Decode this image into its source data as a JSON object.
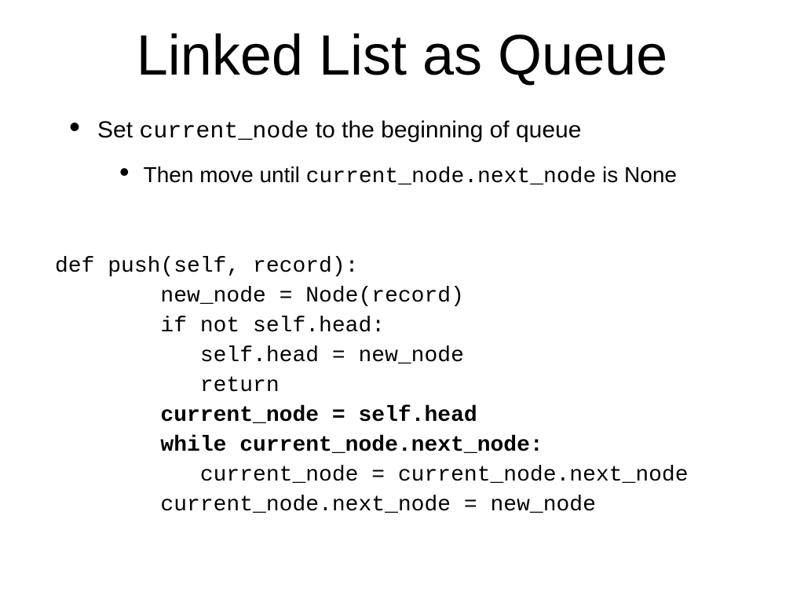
{
  "slide": {
    "title": "Linked List as Queue",
    "bullet1": {
      "pre": "Set ",
      "code": "current_node",
      "post": " to the beginning of queue"
    },
    "bullet2": {
      "pre": "Then move until ",
      "code": "current_node.next_node",
      "post": " is None"
    },
    "code": {
      "l1": "def push(self, record):",
      "l2": "        new_node = Node(record)",
      "l3": "        if not self.head:",
      "l4": "           self.head = new_node",
      "l5": "           return",
      "l6": "        current_node = self.head",
      "l7": "        while current_node.next_node:",
      "l8": "           current_node = current_node.next_node",
      "l9": "        current_node.next_node = new_node"
    }
  }
}
